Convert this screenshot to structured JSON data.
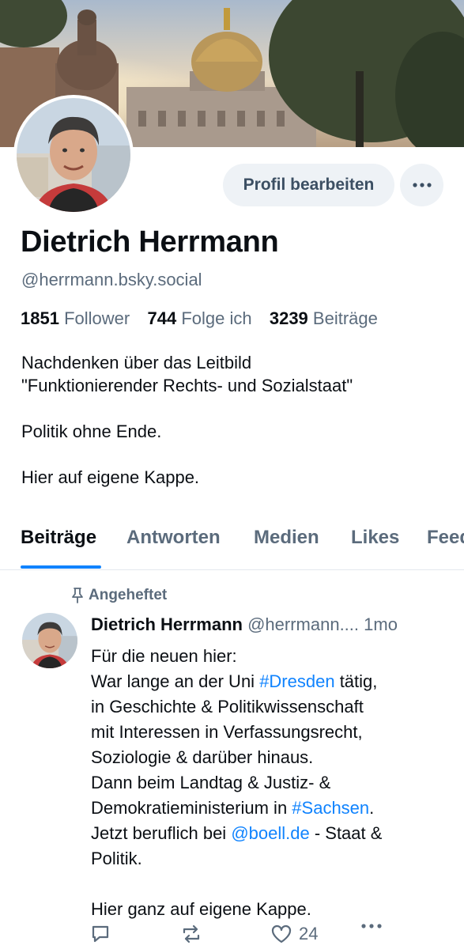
{
  "profile": {
    "name": "Dietrich Herrmann",
    "handle": "@herrmann.bsky.social",
    "edit_button": "Profil bearbeiten",
    "stats": {
      "followers_count": "1851",
      "followers_label": "Follower",
      "following_count": "744",
      "following_label": "Folge ich",
      "posts_count": "3239",
      "posts_label": "Beiträge"
    },
    "bio": [
      "Nachdenken über das Leitbild",
      "\"Funktionierender Rechts- und Sozialstaat\"",
      "Politik ohne Ende.",
      "Hier auf eigene Kappe."
    ]
  },
  "tabs": [
    "Beiträge",
    "Antworten",
    "Medien",
    "Likes",
    "Feeds"
  ],
  "post": {
    "pinned_label": "Angeheftet",
    "author": "Dietrich Herrmann",
    "handle_time": "@herrmann.... 1mo",
    "lines": {
      "l1": "Für die neuen hier:",
      "l2a": "War lange an der Uni ",
      "l2link": "#Dresden",
      "l2b": " tätig,",
      "l3": "in Geschichte & Politikwissenschaft",
      "l4": "mit Interessen in Verfassungsrecht,",
      "l5": "Soziologie & darüber hinaus.",
      "l6": "Dann beim Landtag & Justiz- &",
      "l7a": "Demokratieministerium in ",
      "l7link": "#Sachsen",
      "l7b": ".",
      "l8a": "Jetzt beruflich bei ",
      "l8link": "@boell.de",
      "l8b": " - Staat &",
      "l9": "Politik.",
      "l10": "Hier ganz auf eigene Kappe."
    },
    "likes_count": "24"
  },
  "colors": {
    "accent": "#1083fe",
    "muted": "#5b6b7c",
    "button_bg": "#eef2f6"
  }
}
